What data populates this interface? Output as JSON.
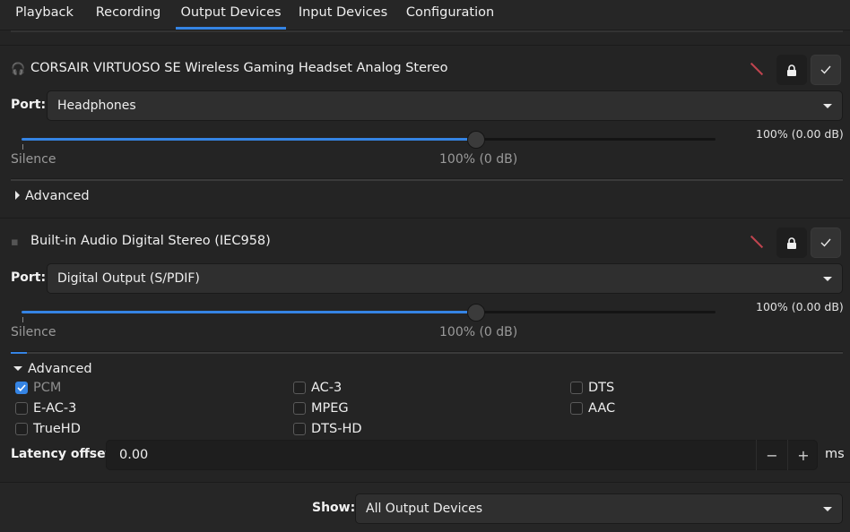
{
  "tabs": [
    {
      "label": "Playback"
    },
    {
      "label": "Recording"
    },
    {
      "label": "Output Devices"
    },
    {
      "label": "Input Devices"
    },
    {
      "label": "Configuration"
    }
  ],
  "active_tab": "Output Devices",
  "devices": [
    {
      "name": "CORSAIR VIRTUOSO SE Wireless Gaming Headset Analog Stereo",
      "port_label": "Port:",
      "port_value": "Headphones",
      "volume_readout": "100% (0.00 dB)",
      "volume_fraction": 1.0,
      "silence_label": "Silence",
      "mark_label": "100% (0 dB)",
      "advanced_label": "Advanced",
      "advanced_expanded": false
    },
    {
      "name": "Built-in Audio Digital Stereo (IEC958)",
      "port_label": "Port:",
      "port_value": "Digital Output (S/PDIF)",
      "volume_readout": "100% (0.00 dB)",
      "volume_fraction": 1.0,
      "silence_label": "Silence",
      "mark_label": "100% (0 dB)",
      "advanced_label": "Advanced",
      "advanced_expanded": true,
      "formats": [
        {
          "label": "PCM",
          "checked": true,
          "disabled": true
        },
        {
          "label": "AC-3",
          "checked": false
        },
        {
          "label": "DTS",
          "checked": false
        },
        {
          "label": "E-AC-3",
          "checked": false
        },
        {
          "label": "MPEG",
          "checked": false
        },
        {
          "label": "AAC",
          "checked": false
        },
        {
          "label": "TrueHD",
          "checked": false
        },
        {
          "label": "DTS-HD",
          "checked": false
        }
      ],
      "latency_label": "Latency offset:",
      "latency_value": "0.00",
      "latency_minus": "−",
      "latency_plus": "+",
      "latency_unit": "ms"
    }
  ],
  "show_label": "Show:",
  "show_value": "All Output Devices",
  "colors": {
    "accent": "#3584e4",
    "mute": "#c0444f",
    "background": "#242424"
  }
}
